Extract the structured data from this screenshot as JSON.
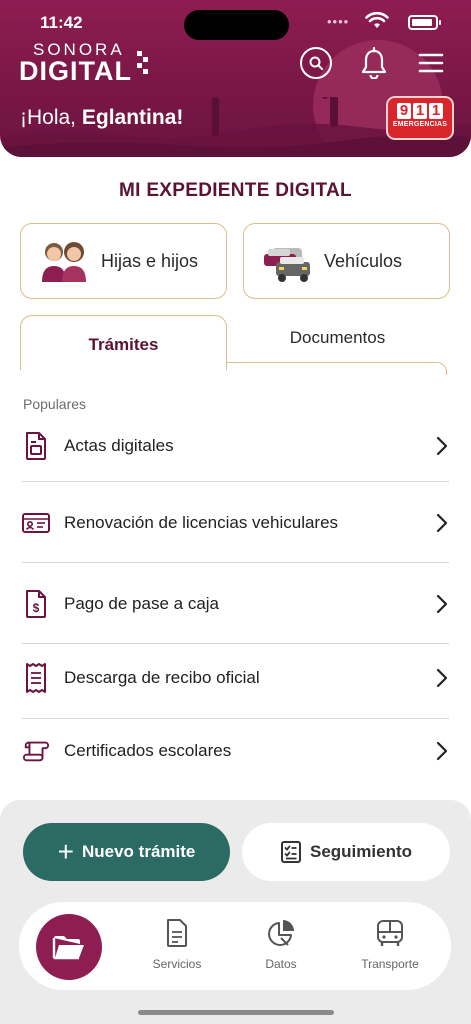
{
  "status_bar": {
    "time": "11:42"
  },
  "header": {
    "logo_top": "SONORA",
    "logo_bottom": "DIGITAL",
    "greeting_prefix": "¡Hola,",
    "greeting_name": "Eglantina!",
    "emergency_number": [
      "9",
      "1",
      "1"
    ],
    "emergency_label": "EMERGENCIAS",
    "icons": [
      "search-icon",
      "bell-icon",
      "menu-icon"
    ]
  },
  "expediente": {
    "title": "MI EXPEDIENTE DIGITAL",
    "cards": [
      {
        "label": "Hijas e hijos",
        "icon": "children-icon"
      },
      {
        "label": "Vehículos",
        "icon": "vehicles-icon"
      }
    ]
  },
  "tabs": [
    {
      "label": "Trámites",
      "active": true
    },
    {
      "label": "Documentos",
      "active": false
    }
  ],
  "list": {
    "caption": "Populares",
    "items": [
      {
        "label": "Actas digitales",
        "icon": "document-icon"
      },
      {
        "label": "Renovación de licencias vehiculares",
        "icon": "id-card-icon"
      },
      {
        "label": "Pago de pase a caja",
        "icon": "payment-document-icon"
      },
      {
        "label": "Descarga de recibo oficial",
        "icon": "receipt-icon"
      },
      {
        "label": "Certificados escolares",
        "icon": "scroll-icon"
      }
    ]
  },
  "actions": {
    "new_label": "Nuevo trámite",
    "track_label": "Seguimiento"
  },
  "nav": {
    "items": [
      {
        "label": "Servicios",
        "icon": "file-icon"
      },
      {
        "label": "Datos",
        "icon": "pie-chart-icon"
      },
      {
        "label": "Transporte",
        "icon": "bus-icon"
      }
    ],
    "fab_icon": "folder-icon"
  },
  "colors": {
    "brand": "#8e1d52",
    "title": "#5c1231",
    "accent_border": "#d8bf8c",
    "primary_button": "#2c6b63",
    "emergency": "#d9262c"
  }
}
